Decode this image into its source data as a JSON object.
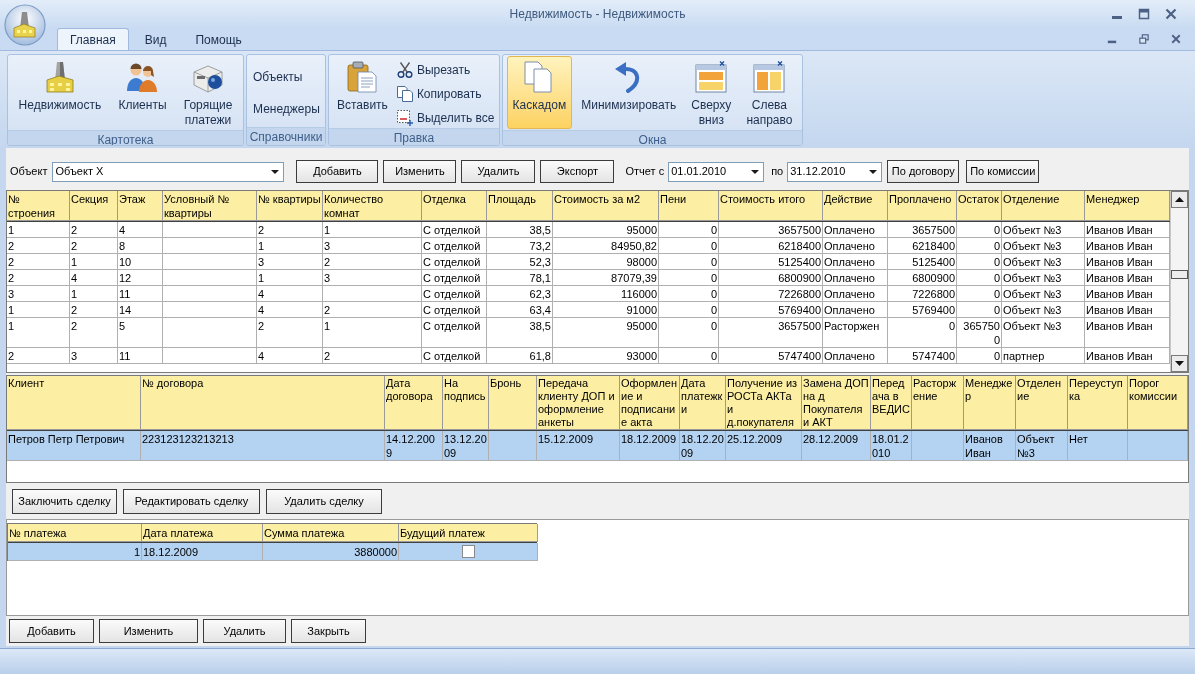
{
  "window": {
    "title": "Недвижимость - Недвижимость"
  },
  "ribbon": {
    "tabs": [
      {
        "label": "Главная",
        "selected": true
      },
      {
        "label": "Вид",
        "selected": false
      },
      {
        "label": "Помощь",
        "selected": false
      }
    ],
    "groups": [
      {
        "label": "Картотека",
        "items": [
          {
            "kind": "large",
            "label": "Недвижимость",
            "active": false
          },
          {
            "kind": "large",
            "label": "Клиенты",
            "active": false
          },
          {
            "kind": "large",
            "label": "Горящие платежи",
            "active": false
          }
        ]
      },
      {
        "label": "Справочники",
        "items": [
          {
            "kind": "text",
            "label": "Объекты",
            "active": false
          },
          {
            "kind": "text",
            "label": "Менеджеры",
            "active": false
          }
        ]
      },
      {
        "label": "Правка",
        "items": [
          {
            "kind": "large",
            "label": "Вставить",
            "active": false
          },
          {
            "kind": "small",
            "label": "Вырезать",
            "active": false
          },
          {
            "kind": "small",
            "label": "Копировать",
            "active": false
          },
          {
            "kind": "small",
            "label": "Выделить все",
            "active": false
          }
        ]
      },
      {
        "label": "Окна",
        "items": [
          {
            "kind": "large",
            "label": "Каскадом",
            "active": true
          },
          {
            "kind": "large",
            "label": "Минимизировать",
            "active": false
          },
          {
            "kind": "large",
            "label": "Сверху вниз",
            "active": false
          },
          {
            "kind": "large",
            "label": "Слева направо",
            "active": false
          }
        ]
      }
    ]
  },
  "filter_bar": {
    "object_label": "Объект",
    "object_value": "Объект X",
    "buttons": [
      "Добавить",
      "Изменить",
      "Удалить",
      "Экспорт"
    ],
    "report_from_label": "Отчет с",
    "report_from": "01.01.2010",
    "report_to_label": "по",
    "report_to": "31.12.2010",
    "report_buttons": [
      "По договору",
      "По комиссии"
    ]
  },
  "properties_table": {
    "columns": [
      {
        "label": "№ строения",
        "kind": "text"
      },
      {
        "label": "Секция",
        "kind": "text"
      },
      {
        "label": "Этаж",
        "kind": "text"
      },
      {
        "label": "Условный № квартиры",
        "kind": "text"
      },
      {
        "label": "№ квартиры",
        "kind": "text"
      },
      {
        "label": "Количество комнат",
        "kind": "text"
      },
      {
        "label": "Отделка",
        "kind": "text"
      },
      {
        "label": "Площадь",
        "kind": "number"
      },
      {
        "label": "Стоимость за м2",
        "kind": "number"
      },
      {
        "label": "Пени",
        "kind": "number"
      },
      {
        "label": "Стоимость итого",
        "kind": "number"
      },
      {
        "label": "Действие",
        "kind": "text"
      },
      {
        "label": "Проплачено",
        "kind": "number"
      },
      {
        "label": "Остаток",
        "kind": "number"
      },
      {
        "label": "Отделение",
        "kind": "text"
      },
      {
        "label": "Менеджер",
        "kind": "text"
      }
    ],
    "rows": [
      {
        "selected": false,
        "cells": [
          "1",
          "2",
          "4",
          null,
          "2",
          "1",
          "С отделкой",
          "38,5",
          "95000",
          "0",
          "3657500",
          "Оплачено",
          "3657500",
          "0",
          "Объект №3",
          "Иванов Иван"
        ]
      },
      {
        "selected": false,
        "cells": [
          "2",
          "2",
          "8",
          null,
          "1",
          "3",
          "С отделкой",
          "73,2",
          "84950,82",
          "0",
          "6218400",
          "Оплачено",
          "6218400",
          "0",
          "Объект №3",
          "Иванов Иван"
        ]
      },
      {
        "selected": false,
        "cells": [
          "2",
          "1",
          "10",
          null,
          "3",
          "2",
          "С отделкой",
          "52,3",
          "98000",
          "0",
          "5125400",
          "Оплачено",
          "5125400",
          "0",
          "Объект №3",
          "Иванов Иван"
        ]
      },
      {
        "selected": false,
        "cells": [
          "2",
          "4",
          "12",
          null,
          "1",
          "3",
          "С отделкой",
          "78,1",
          "87079,39",
          "0",
          "6800900",
          "Оплачено",
          "6800900",
          "0",
          "Объект №3",
          "Иванов Иван"
        ]
      },
      {
        "selected": false,
        "cells": [
          "3",
          "1",
          "11",
          null,
          "4",
          null,
          "С отделкой",
          "62,3",
          "116000",
          "0",
          "7226800",
          "Оплачено",
          "7226800",
          "0",
          "Объект №3",
          "Иванов Иван"
        ]
      },
      {
        "selected": false,
        "cells": [
          "1",
          "2",
          "14",
          null,
          "4",
          "2",
          "С отделкой",
          "63,4",
          "91000",
          "0",
          "5769400",
          "Оплачено",
          "5769400",
          "0",
          "Объект №3",
          "Иванов Иван"
        ]
      },
      {
        "selected": false,
        "cells": [
          "1",
          "2",
          "5",
          null,
          "2",
          "1",
          "С отделкой",
          "38,5",
          "95000",
          "0",
          "3657500",
          "Расторжен",
          "0",
          "3657500",
          "Объект №3",
          "Иванов Иван"
        ]
      },
      {
        "selected": false,
        "cells": [
          "2",
          "3",
          "11",
          null,
          "4",
          "2",
          "С отделкой",
          "61,8",
          "93000",
          "0",
          "5747400",
          "Оплачено",
          "5747400",
          "0",
          "партнер",
          "Иванов Иван"
        ]
      }
    ]
  },
  "deals_table": {
    "columns": [
      "Клиент",
      "№ договора",
      "Дата договора",
      "На подпись",
      "Бронь",
      "Передача клиенту ДОП и оформление анкеты",
      "Оформление и подписание акта",
      "Дата платежки",
      "Получение из РОСТа АКТа и д.покупателя",
      "Замена ДОП на д Покупателя и АКТ",
      "Передача в ВЕДИС",
      "Расторжение",
      "Менеджер",
      "Отделение",
      "Переуступка",
      "Порог комиссии"
    ],
    "rows": [
      {
        "selected": true,
        "cells": [
          "Петров Петр Петрович",
          "223123123213213",
          "14.12.2009",
          "13.12.2009",
          null,
          "15.12.2009",
          "18.12.2009",
          "18.12.2009",
          "25.12.2009",
          "28.12.2009",
          "18.01.2010",
          null,
          "Иванов Иван",
          "Объект №3",
          "Нет",
          null
        ]
      }
    ]
  },
  "deal_buttons": [
    "Заключить сделку",
    "Редактировать сделку",
    "Удалить сделку"
  ],
  "payments_table": {
    "columns": [
      {
        "label": "№ платежа",
        "kind": "number"
      },
      {
        "label": "Дата платежа",
        "kind": "text"
      },
      {
        "label": "Сумма платежа",
        "kind": "number"
      },
      {
        "label": "Будущий платеж",
        "kind": "checkbox"
      }
    ],
    "rows": [
      {
        "selected": true,
        "cells": [
          "1",
          "18.12.2009",
          "3880000"
        ],
        "checked": false
      }
    ]
  },
  "bottom_buttons": [
    "Добавить",
    "Изменить",
    "Удалить",
    "Закрыть"
  ]
}
